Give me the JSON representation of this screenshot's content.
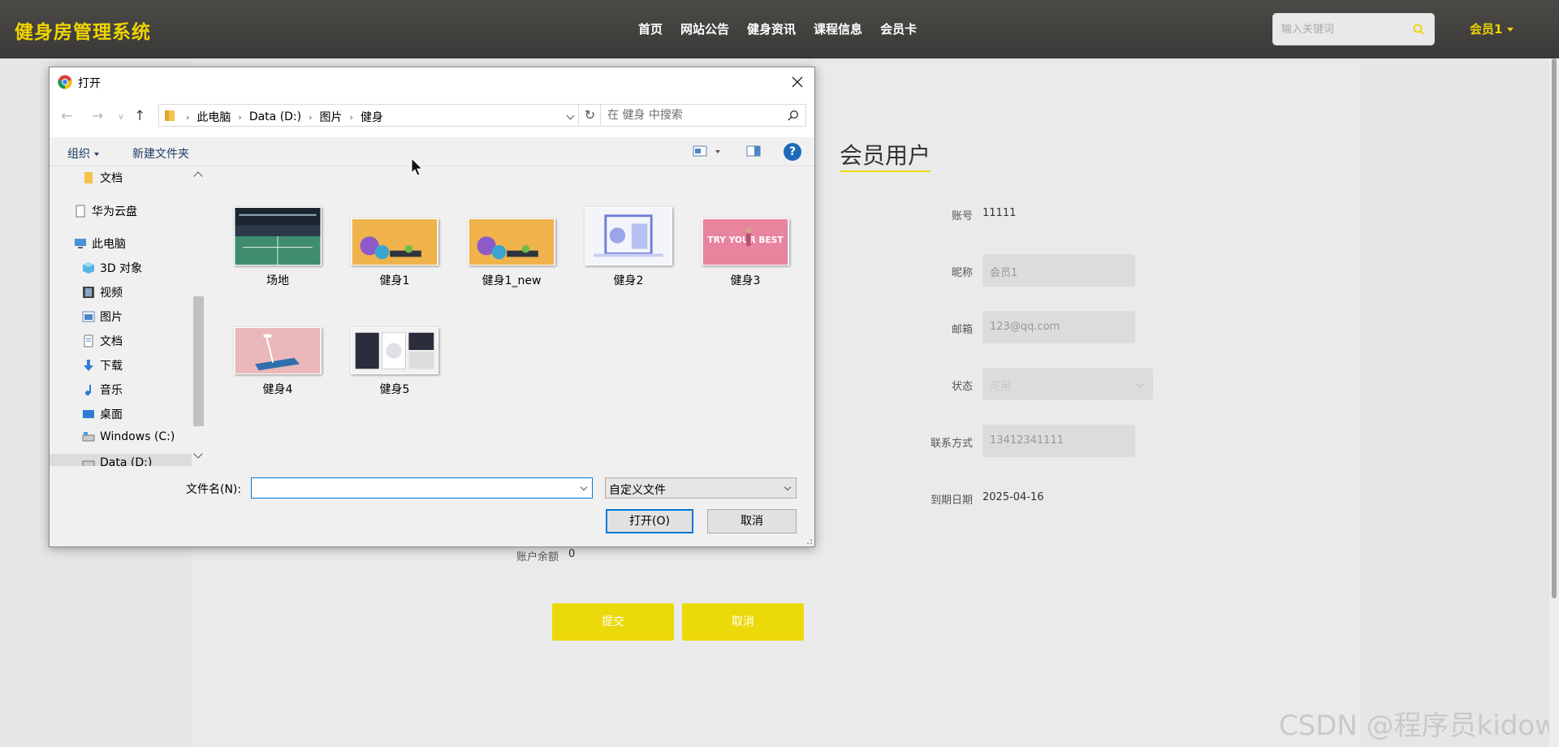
{
  "header": {
    "brand": "健身房管理系统",
    "nav": [
      "首页",
      "网站公告",
      "健身资讯",
      "课程信息",
      "会员卡"
    ],
    "search_placeholder": "输入关键词",
    "user": "会员1"
  },
  "profile": {
    "title": "会员用户",
    "fields": {
      "account_label": "账号",
      "account_value": "11111",
      "nickname_label": "昵称",
      "nickname_value": "会员1",
      "email_label": "邮箱",
      "email_value": "123@qq.com",
      "status_label": "状态",
      "status_value": "可用",
      "contact_label": "联系方式",
      "contact_value": "13412341111",
      "expiry_label": "到期日期",
      "expiry_value": "2025-04-16",
      "balance_label": "账户余额",
      "balance_value": "0"
    },
    "submit": "提交",
    "cancel": "取消"
  },
  "dialog": {
    "title": "打开",
    "breadcrumb": [
      "此电脑",
      "Data (D:)",
      "图片",
      "健身"
    ],
    "search_placeholder": "在 健身 中搜索",
    "toolbar": {
      "organize": "组织",
      "new_folder": "新建文件夹",
      "help": "?"
    },
    "tree": [
      {
        "label": "文档",
        "icon": "folder-icon"
      },
      {
        "label": "华为云盘",
        "icon": "cloud-drive-icon"
      },
      {
        "label": "此电脑",
        "icon": "computer-icon"
      },
      {
        "label": "3D 对象",
        "icon": "cube-icon"
      },
      {
        "label": "视频",
        "icon": "video-icon"
      },
      {
        "label": "图片",
        "icon": "pictures-icon"
      },
      {
        "label": "文档",
        "icon": "documents-icon"
      },
      {
        "label": "下载",
        "icon": "download-icon"
      },
      {
        "label": "音乐",
        "icon": "music-icon"
      },
      {
        "label": "桌面",
        "icon": "desktop-icon"
      },
      {
        "label": "Windows (C:)",
        "icon": "drive-icon"
      },
      {
        "label": "Data (D:)",
        "icon": "drive-icon"
      }
    ],
    "files": [
      "场地",
      "健身1",
      "健身1_new",
      "健身2",
      "健身3",
      "健身4",
      "健身5"
    ],
    "thumb3_text": "TRY YOUR BEST",
    "filename_label": "文件名(N):",
    "filename_value": "",
    "filetype": "自定义文件",
    "open_btn": "打开(O)",
    "cancel_btn": "取消"
  },
  "watermark": "CSDN @程序员kidow",
  "colors": {
    "accent": "#ecd90a",
    "header": "#3f3e3c",
    "brand": "#f0d400",
    "dialog_focus": "#0078d7"
  }
}
